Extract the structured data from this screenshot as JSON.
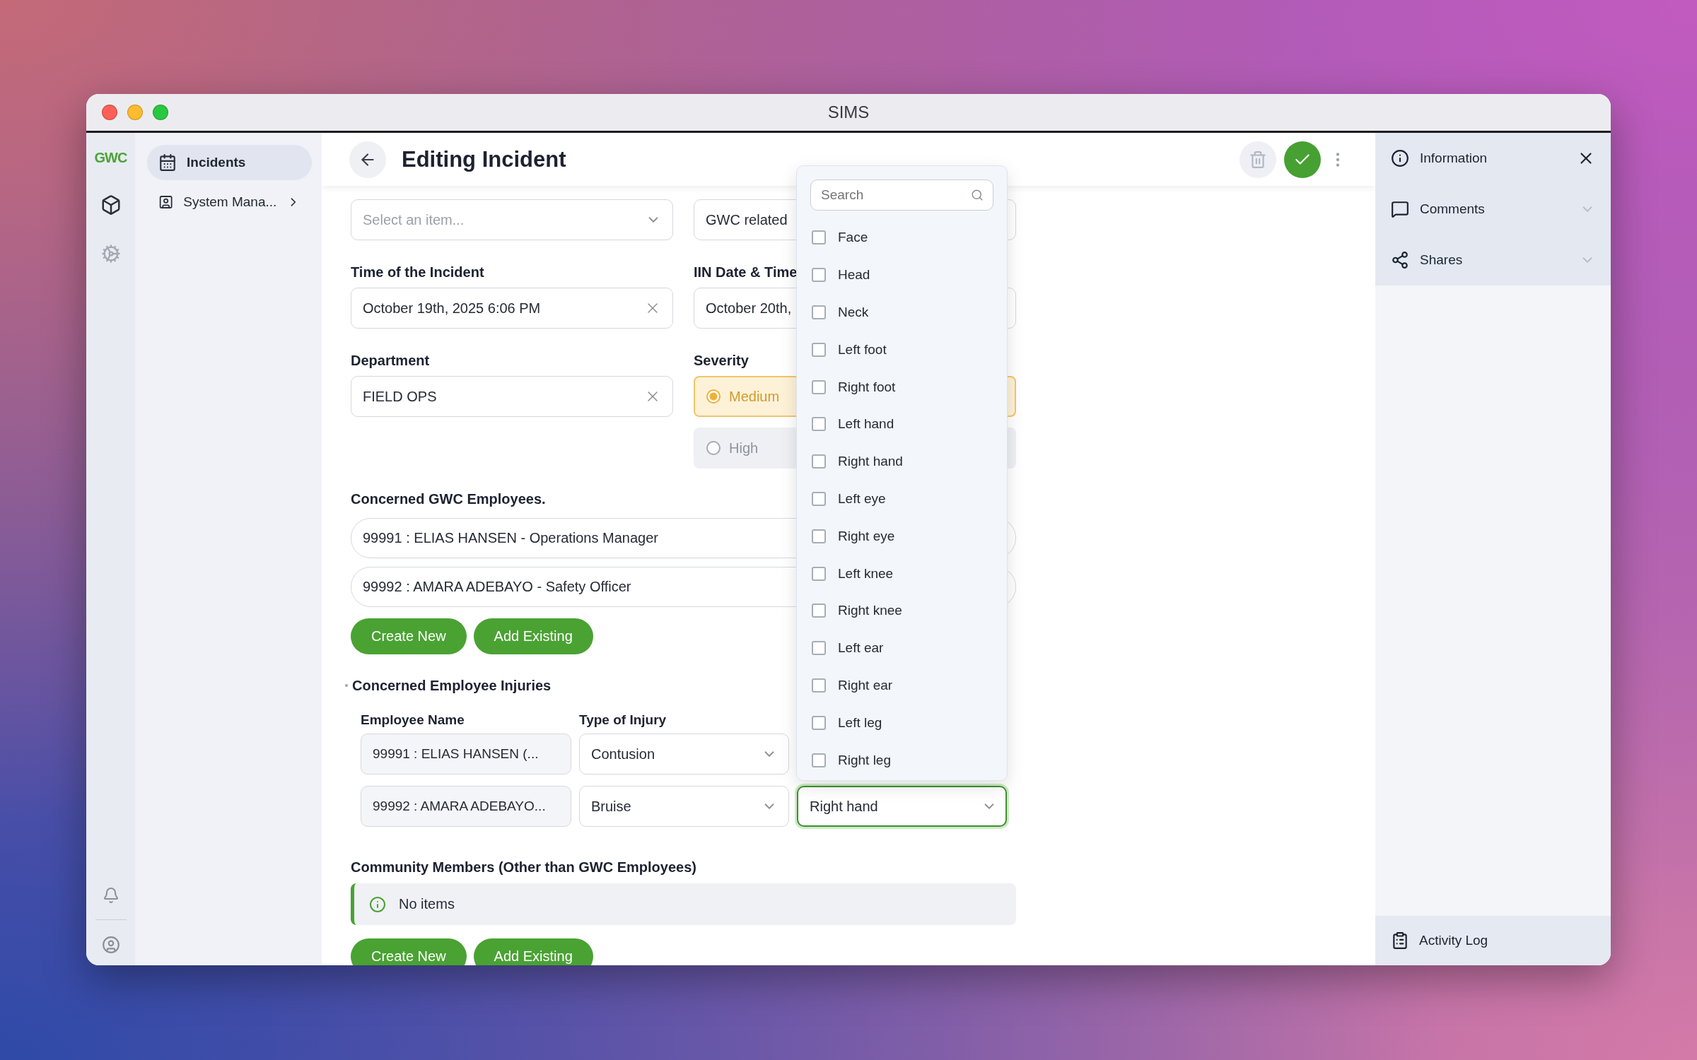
{
  "window": {
    "title": "SIMS"
  },
  "rail": {
    "logo": "GWC"
  },
  "nav": [
    {
      "label": "Incidents",
      "kind": "page",
      "selected": true
    },
    {
      "label": "System Mana...",
      "kind": "group",
      "selected": false
    }
  ],
  "header": {
    "title": "Editing Incident"
  },
  "form": {
    "left": [
      {
        "kind": "select",
        "placeholder": "Select an item..."
      },
      {
        "kind": "clearable",
        "label": "Time of the Incident",
        "value": "October 19th, 2025 6:06 PM"
      },
      {
        "kind": "clearable",
        "label": "Department",
        "value": "FIELD OPS"
      }
    ],
    "right": [
      {
        "kind": "plain",
        "value": "GWC related"
      },
      {
        "kind": "plain",
        "label": "IIN Date & Time",
        "value": "October 20th,"
      },
      {
        "kind": "radio",
        "label": "Severity",
        "options": [
          {
            "label": "Medium",
            "selected": true
          },
          {
            "label": "High",
            "selected": false
          }
        ]
      }
    ]
  },
  "employees": {
    "title": "Concerned GWC Employees.",
    "items": [
      "99991 : ELIAS HANSEN - Operations Manager",
      "99992 : AMARA ADEBAYO - Safety Officer"
    ],
    "buttons": [
      "Create New",
      "Add Existing"
    ]
  },
  "injuries": {
    "title": "Concerned Employee Injuries",
    "columns": [
      "Employee Name",
      "Type of Injury"
    ],
    "rows": [
      {
        "employee": "99991 : ELIAS HANSEN (...",
        "type": "Contusion"
      },
      {
        "employee": "99992 : AMARA ADEBAYO...",
        "type": "Bruise",
        "body_part": {
          "value": "Right hand",
          "focused": true
        }
      }
    ]
  },
  "community": {
    "title": "Community Members (Other than GWC Employees)",
    "empty": "No items",
    "buttons": [
      "Create New",
      "Add Existing"
    ]
  },
  "dropdown": {
    "search_placeholder": "Search",
    "options": [
      {
        "label": "Face",
        "checked": false
      },
      {
        "label": "Head",
        "checked": false
      },
      {
        "label": "Neck",
        "checked": false
      },
      {
        "label": "Left foot",
        "checked": false
      },
      {
        "label": "Right foot",
        "checked": false
      },
      {
        "label": "Left hand",
        "checked": false
      },
      {
        "label": "Right hand",
        "checked": false
      },
      {
        "label": "Left eye",
        "checked": false
      },
      {
        "label": "Right eye",
        "checked": false
      },
      {
        "label": "Left knee",
        "checked": false
      },
      {
        "label": "Right knee",
        "checked": false
      },
      {
        "label": "Left ear",
        "checked": false
      },
      {
        "label": "Right ear",
        "checked": false
      },
      {
        "label": "Left leg",
        "checked": false
      },
      {
        "label": "Right leg",
        "checked": false
      }
    ]
  },
  "right_panel": {
    "sections": [
      {
        "label": "Information",
        "kind": "close"
      },
      {
        "label": "Comments",
        "kind": "collapsible"
      },
      {
        "label": "Shares",
        "kind": "collapsible"
      }
    ],
    "activity_log": "Activity Log"
  }
}
